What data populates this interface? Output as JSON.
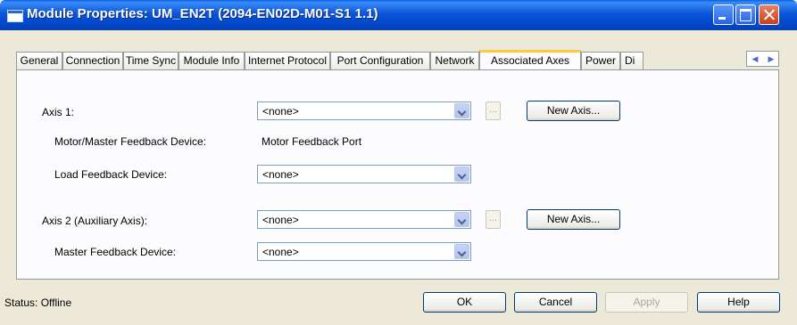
{
  "window": {
    "title": "Module Properties: UM_EN2T (2094-EN02D-M01-S1 1.1)"
  },
  "tabs": [
    {
      "label": "General"
    },
    {
      "label": "Connection"
    },
    {
      "label": "Time Sync"
    },
    {
      "label": "Module Info"
    },
    {
      "label": "Internet Protocol"
    },
    {
      "label": "Port Configuration"
    },
    {
      "label": "Network"
    },
    {
      "label": "Associated Axes"
    },
    {
      "label": "Power"
    },
    {
      "label": "Di"
    }
  ],
  "active_tab": "Associated Axes",
  "form": {
    "axis1": {
      "label": "Axis 1:",
      "value": "<none>",
      "ellipsis": "...",
      "new_axis": "New Axis..."
    },
    "motor_master_feedback": {
      "label": "Motor/Master Feedback Device:",
      "value": "Motor Feedback Port"
    },
    "load_feedback": {
      "label": "Load Feedback Device:",
      "value": "<none>"
    },
    "axis2": {
      "label": "Axis 2  (Auxiliary Axis):",
      "value": "<none>",
      "ellipsis": "...",
      "new_axis": "New Axis..."
    },
    "master_feedback": {
      "label": "Master Feedback Device:",
      "value": "<none>"
    }
  },
  "status": {
    "label": "Status:  Offline"
  },
  "buttons": {
    "ok": "OK",
    "cancel": "Cancel",
    "apply": "Apply",
    "help": "Help"
  },
  "colors": {
    "active_tab_accent": "#FFC83C",
    "title_bar": "#0A55D8",
    "dialog_bg": "#ECE9D8"
  }
}
